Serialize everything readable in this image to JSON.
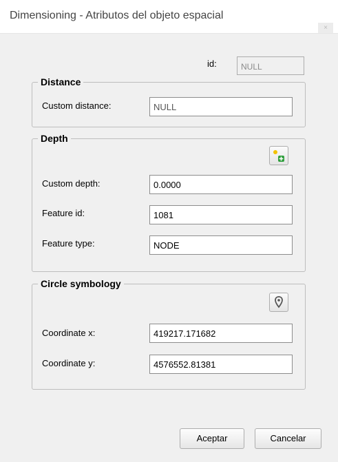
{
  "window": {
    "title": "Dimensioning - Atributos del objeto espacial",
    "close_glyph": "×"
  },
  "id_field": {
    "label": "id:",
    "value": "NULL"
  },
  "distance": {
    "legend": "Distance",
    "custom_distance_label": "Custom distance:",
    "custom_distance_value": "NULL"
  },
  "depth": {
    "legend": "Depth",
    "add_point_button_icon": "add-point-icon",
    "custom_depth_label": "Custom depth:",
    "custom_depth_value": "0.0000",
    "feature_id_label": "Feature id:",
    "feature_id_value": "1081",
    "feature_type_label": "Feature type:",
    "feature_type_value": "NODE"
  },
  "circle_symbology": {
    "legend": "Circle symbology",
    "locate_button_icon": "map-marker-icon",
    "coord_x_label": "Coordinate x:",
    "coord_x_value": "419217.171682",
    "coord_y_label": "Coordinate y:",
    "coord_y_value": "4576552.81381"
  },
  "buttons": {
    "accept": "Aceptar",
    "cancel": "Cancelar"
  },
  "colors": {
    "point_yellow": "#f2c200",
    "plus_green": "#2e9e3c",
    "marker_dark": "#555555"
  }
}
